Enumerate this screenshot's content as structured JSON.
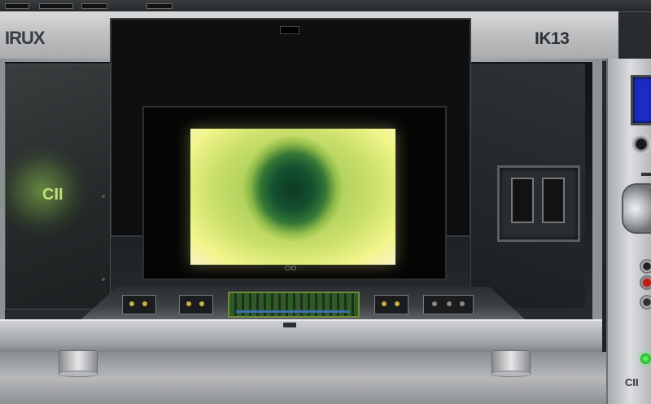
{
  "header": {
    "brand_left": "IRUX",
    "brand_right": "IK13"
  },
  "panel": {
    "left_label": "CII",
    "display_label": "CIO"
  },
  "controls": {
    "bottom_label": "CII"
  },
  "colors": {
    "display_glow": "#f1f58a",
    "display_center": "#0d3a24",
    "lcd": "#1d2bc4",
    "led_green": "#1fae2a",
    "button_red": "#c21818"
  }
}
